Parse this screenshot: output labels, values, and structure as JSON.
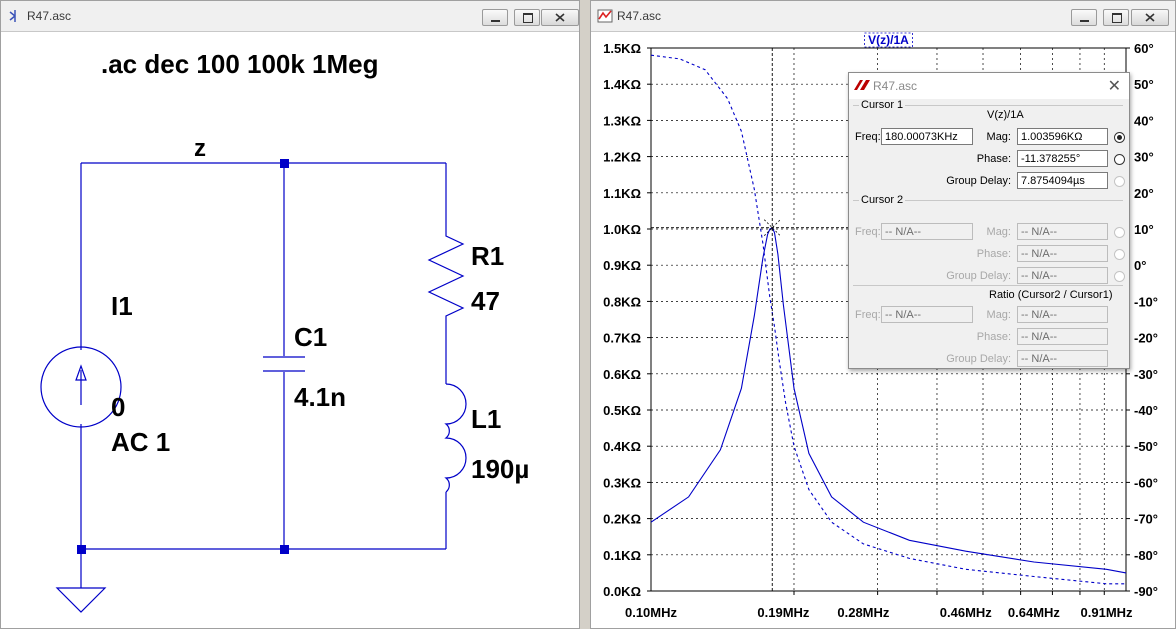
{
  "schematic": {
    "window_title": "R47.asc",
    "directive": ".ac dec 100 100k 1Meg",
    "net_label": "z",
    "source_name": "I1",
    "source_value_1": "0",
    "source_value_2": "AC 1",
    "cap_name": "C1",
    "cap_value": "4.1n",
    "res_name": "R1",
    "res_value": "47",
    "ind_name": "L1",
    "ind_value": "190µ"
  },
  "waveform": {
    "window_title": "R47.asc",
    "trace_label": "V(z)/1A",
    "trace_color": "#0000c8",
    "y_left_ticks": [
      "1.5KΩ",
      "1.4KΩ",
      "1.3KΩ",
      "1.2KΩ",
      "1.1KΩ",
      "1.0KΩ",
      "0.9KΩ",
      "0.8KΩ",
      "0.7KΩ",
      "0.6KΩ",
      "0.5KΩ",
      "0.4KΩ",
      "0.3KΩ",
      "0.2KΩ",
      "0.1KΩ",
      "0.0KΩ"
    ],
    "y_right_ticks": [
      "60°",
      "50°",
      "40°",
      "30°",
      "20°",
      "10°",
      "0°",
      "-10°",
      "-20°",
      "-30°",
      "-40°",
      "-50°",
      "-60°",
      "-70°",
      "-80°",
      "-90°"
    ],
    "x_ticks": [
      "0.10MHz",
      "0.19MHz",
      "0.28MHz",
      "0.46MHz",
      "0.64MHz",
      "0.91MHz"
    ]
  },
  "cursor_dialog": {
    "title": "R47.asc",
    "cursor1_label": "Cursor 1",
    "trace_name": "V(z)/1A",
    "freq_label": "Freq:",
    "freq_value": "180.00073KHz",
    "mag_label": "Mag:",
    "mag_value": "1.003596KΩ",
    "phase_label": "Phase:",
    "phase_value": "-11.378255°",
    "gd_label": "Group Delay:",
    "gd_value": "7.8754094µs",
    "cursor2_label": "Cursor 2",
    "na": "-- N/A--",
    "ratio_label": "Ratio (Cursor2 / Cursor1)"
  },
  "chart_data": {
    "type": "line",
    "title": "",
    "xlabel": "",
    "ylabel": "",
    "x_scale": "log",
    "xlim": [
      100000,
      1000000
    ],
    "ylim": [
      0,
      1500
    ],
    "y2lim": [
      -90,
      60
    ],
    "grid": true,
    "x_unit": "Hz",
    "y_unit": "Ω",
    "y2_unit": "°",
    "series": [
      {
        "name": "V(z)/1A",
        "axis": "magnitude",
        "style": "solid",
        "x": [
          100000,
          120000,
          140000,
          155000,
          165000,
          172000,
          176000,
          178000,
          180000,
          182000,
          185000,
          190000,
          200000,
          215000,
          240000,
          280000,
          350000,
          460000,
          640000,
          910000,
          1000000
        ],
        "y": [
          190,
          260,
          390,
          560,
          760,
          920,
          985,
          1000,
          1004,
          990,
          930,
          790,
          560,
          380,
          260,
          190,
          140,
          110,
          80,
          60,
          50
        ]
      },
      {
        "name": "",
        "axis": "phase",
        "style": "dashed",
        "x": [
          100000,
          115000,
          130000,
          145000,
          155000,
          165000,
          172000,
          178000,
          182000,
          186000,
          192000,
          200000,
          215000,
          240000,
          280000,
          350000,
          460000,
          640000,
          910000,
          1000000
        ],
        "y": [
          58,
          57,
          54,
          46,
          37,
          21,
          6,
          -9,
          -17,
          -26,
          -38,
          -50,
          -62,
          -71,
          -77,
          -81,
          -84,
          -86,
          -88,
          -88
        ]
      }
    ],
    "cursor": {
      "x": 180000,
      "y": 1003.6
    }
  }
}
